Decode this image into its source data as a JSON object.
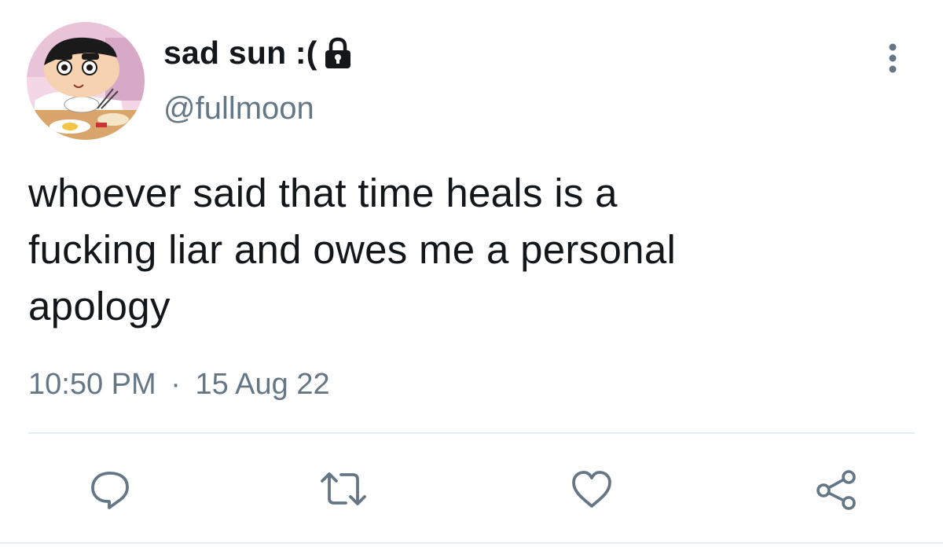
{
  "tweet": {
    "display_name": "sad sun :(",
    "handle": "@fullmoon",
    "text_lines": [
      "whoever said that time heals is a",
      "fucking liar and owes me a personal",
      "apology"
    ],
    "time": "10:50 PM",
    "separator": "·",
    "date": "15 Aug 22",
    "protected": true
  },
  "icons": {
    "lock": "lock-icon",
    "more": "vertical-dots-icon",
    "reply": "reply-icon",
    "retweet": "retweet-icon",
    "like": "heart-icon",
    "share": "share-icon"
  },
  "colors": {
    "text": "#14171a",
    "secondary": "#657786",
    "divider": "#e6ecf0"
  }
}
